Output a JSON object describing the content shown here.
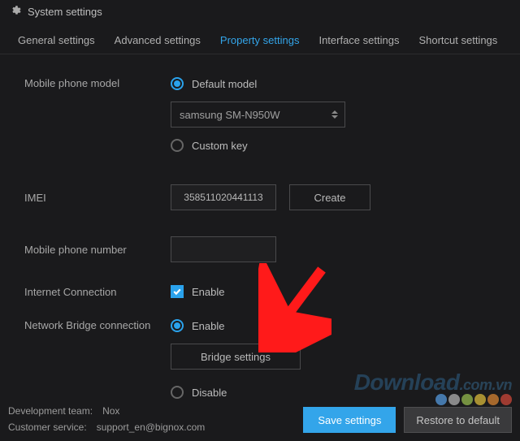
{
  "window": {
    "title": "System settings"
  },
  "tabs": {
    "general": "General settings",
    "advanced": "Advanced settings",
    "property": "Property settings",
    "interface": "Interface settings",
    "shortcut": "Shortcut settings"
  },
  "model": {
    "label": "Mobile phone model",
    "default_label": "Default model",
    "select_value": "samsung SM-N950W",
    "custom_label": "Custom key"
  },
  "imei": {
    "label": "IMEI",
    "value": "358511020441113",
    "create_label": "Create"
  },
  "phone_number": {
    "label": "Mobile phone number",
    "value": ""
  },
  "internet": {
    "label": "Internet Connection",
    "enable_label": "Enable"
  },
  "bridge": {
    "label": "Network Bridge connection",
    "enable_label": "Enable",
    "settings_label": "Bridge settings",
    "disable_label": "Disable"
  },
  "footer": {
    "dev_label": "Development team:",
    "dev_value": "Nox",
    "cs_label": "Customer service:",
    "cs_value": "support_en@bignox.com",
    "save": "Save settings",
    "restore": "Restore to default"
  },
  "watermark": {
    "brand": "Download",
    "domain": ".com.vn"
  },
  "dot_colors": [
    "#58a0e8",
    "#b9b9b9",
    "#9cc451",
    "#e4c23c",
    "#e28a34",
    "#d84a3a"
  ]
}
